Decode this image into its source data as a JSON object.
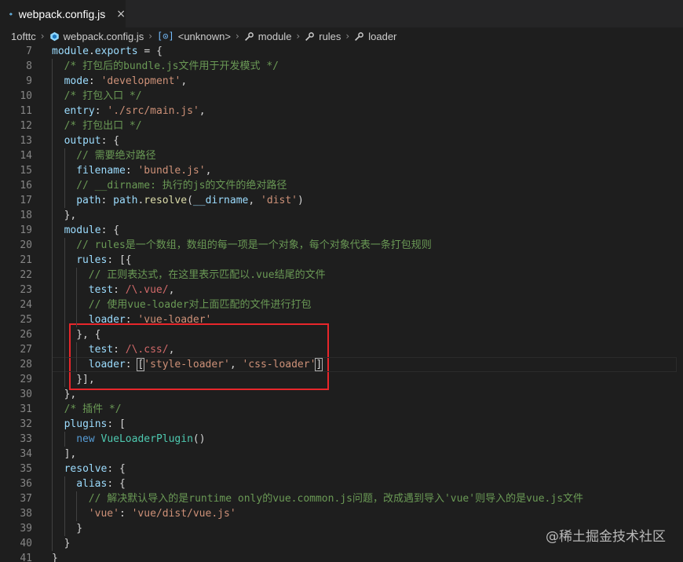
{
  "tab": {
    "label": "webpack.config.js",
    "close": "×"
  },
  "breadcrumbs": [
    "1ofttc",
    "webpack.config.js",
    "<unknown>",
    "module",
    "rules",
    "loader"
  ],
  "watermark": "@稀土掘金技术社区",
  "colors": {
    "highlight_box": "#e8262b",
    "background": "#1e1e1e"
  },
  "code_lines": [
    {
      "n": "7",
      "indent": 0,
      "tokens": [
        [
          "var",
          "module"
        ],
        [
          "p",
          "."
        ],
        [
          "var",
          "exports"
        ],
        [
          "p",
          " = {"
        ]
      ]
    },
    {
      "n": "8",
      "indent": 1,
      "tokens": [
        [
          "cm",
          "/* 打包后的bundle.js文件用于开发模式 */"
        ]
      ]
    },
    {
      "n": "9",
      "indent": 1,
      "tokens": [
        [
          "var",
          "mode"
        ],
        [
          "p",
          ": "
        ],
        [
          "str",
          "'development'"
        ],
        [
          "p",
          ","
        ]
      ]
    },
    {
      "n": "10",
      "indent": 1,
      "tokens": [
        [
          "cm",
          "/* 打包入口 */"
        ]
      ]
    },
    {
      "n": "11",
      "indent": 1,
      "tokens": [
        [
          "var",
          "entry"
        ],
        [
          "p",
          ": "
        ],
        [
          "str",
          "'./src/main.js'"
        ],
        [
          "p",
          ","
        ]
      ]
    },
    {
      "n": "12",
      "indent": 1,
      "tokens": [
        [
          "cm",
          "/* 打包出口 */"
        ]
      ]
    },
    {
      "n": "13",
      "indent": 1,
      "tokens": [
        [
          "var",
          "output"
        ],
        [
          "p",
          ": {"
        ]
      ]
    },
    {
      "n": "14",
      "indent": 2,
      "tokens": [
        [
          "cm",
          "// 需要绝对路径"
        ]
      ]
    },
    {
      "n": "15",
      "indent": 2,
      "tokens": [
        [
          "var",
          "filename"
        ],
        [
          "p",
          ": "
        ],
        [
          "str",
          "'bundle.js'"
        ],
        [
          "p",
          ","
        ]
      ]
    },
    {
      "n": "16",
      "indent": 2,
      "tokens": [
        [
          "cm",
          "// __dirname: 执行的js的文件的绝对路径"
        ]
      ]
    },
    {
      "n": "17",
      "indent": 2,
      "tokens": [
        [
          "var",
          "path"
        ],
        [
          "p",
          ": "
        ],
        [
          "var",
          "path"
        ],
        [
          "p",
          "."
        ],
        [
          "fn",
          "resolve"
        ],
        [
          "p",
          "("
        ],
        [
          "var",
          "__dirname"
        ],
        [
          "p",
          ", "
        ],
        [
          "str",
          "'dist'"
        ],
        [
          "p",
          ")"
        ]
      ]
    },
    {
      "n": "18",
      "indent": 1,
      "tokens": [
        [
          "p",
          "},"
        ]
      ]
    },
    {
      "n": "19",
      "indent": 1,
      "tokens": [
        [
          "var",
          "module"
        ],
        [
          "p",
          ": {"
        ]
      ]
    },
    {
      "n": "20",
      "indent": 2,
      "tokens": [
        [
          "cm",
          "// rules是一个数组，数组的每一项是一个对象，每个对象代表一条打包规则"
        ]
      ]
    },
    {
      "n": "21",
      "indent": 2,
      "tokens": [
        [
          "var",
          "rules"
        ],
        [
          "p",
          ": [{"
        ]
      ]
    },
    {
      "n": "22",
      "indent": 3,
      "tokens": [
        [
          "cm",
          "// 正则表达式，在这里表示匹配以.vue结尾的文件"
        ]
      ]
    },
    {
      "n": "23",
      "indent": 3,
      "tokens": [
        [
          "var",
          "test"
        ],
        [
          "p",
          ": "
        ],
        [
          "rx",
          "/\\.vue/"
        ],
        [
          "p",
          ","
        ]
      ]
    },
    {
      "n": "24",
      "indent": 3,
      "tokens": [
        [
          "cm",
          "// 使用vue-loader对上面匹配的文件进行打包"
        ]
      ]
    },
    {
      "n": "25",
      "indent": 3,
      "tokens": [
        [
          "var",
          "loader"
        ],
        [
          "p",
          ": "
        ],
        [
          "str",
          "'vue-loader'"
        ]
      ]
    },
    {
      "n": "26",
      "indent": 2,
      "tokens": [
        [
          "p",
          "}, {"
        ]
      ]
    },
    {
      "n": "27",
      "indent": 3,
      "tokens": [
        [
          "var",
          "test"
        ],
        [
          "p",
          ": "
        ],
        [
          "rx",
          "/\\.css/"
        ],
        [
          "p",
          ","
        ]
      ]
    },
    {
      "n": "28",
      "indent": 3,
      "tokens": [
        [
          "var",
          "loader"
        ],
        [
          "p",
          ": "
        ],
        [
          "bm",
          "["
        ],
        [
          "str",
          "'style-loader'"
        ],
        [
          "p",
          ", "
        ],
        [
          "str",
          "'css-loader'"
        ],
        [
          "bm",
          "]"
        ]
      ]
    },
    {
      "n": "29",
      "indent": 2,
      "tokens": [
        [
          "p",
          "}],"
        ]
      ]
    },
    {
      "n": "30",
      "indent": 1,
      "tokens": [
        [
          "p",
          "},"
        ]
      ]
    },
    {
      "n": "31",
      "indent": 1,
      "tokens": [
        [
          "cm",
          "/* 插件 */"
        ]
      ]
    },
    {
      "n": "32",
      "indent": 1,
      "tokens": [
        [
          "var",
          "plugins"
        ],
        [
          "p",
          ": ["
        ]
      ]
    },
    {
      "n": "33",
      "indent": 2,
      "tokens": [
        [
          "kw",
          "new "
        ],
        [
          "cls",
          "VueLoaderPlugin"
        ],
        [
          "p",
          "()"
        ]
      ]
    },
    {
      "n": "34",
      "indent": 1,
      "tokens": [
        [
          "p",
          "],"
        ]
      ]
    },
    {
      "n": "35",
      "indent": 1,
      "tokens": [
        [
          "var",
          "resolve"
        ],
        [
          "p",
          ": {"
        ]
      ]
    },
    {
      "n": "36",
      "indent": 2,
      "tokens": [
        [
          "var",
          "alias"
        ],
        [
          "p",
          ": {"
        ]
      ]
    },
    {
      "n": "37",
      "indent": 3,
      "tokens": [
        [
          "cm",
          "// 解决默认导入的是runtime only的vue.common.js问题，改成遇到导入'vue'则导入的是vue.js文件"
        ]
      ]
    },
    {
      "n": "38",
      "indent": 3,
      "tokens": [
        [
          "str",
          "'vue'"
        ],
        [
          "p",
          ": "
        ],
        [
          "str",
          "'vue/dist/vue.js'"
        ]
      ]
    },
    {
      "n": "39",
      "indent": 2,
      "tokens": [
        [
          "p",
          "}"
        ]
      ]
    },
    {
      "n": "40",
      "indent": 1,
      "tokens": [
        [
          "p",
          "}"
        ]
      ]
    },
    {
      "n": "41",
      "indent": 0,
      "tokens": [
        [
          "p",
          "}"
        ]
      ]
    }
  ]
}
